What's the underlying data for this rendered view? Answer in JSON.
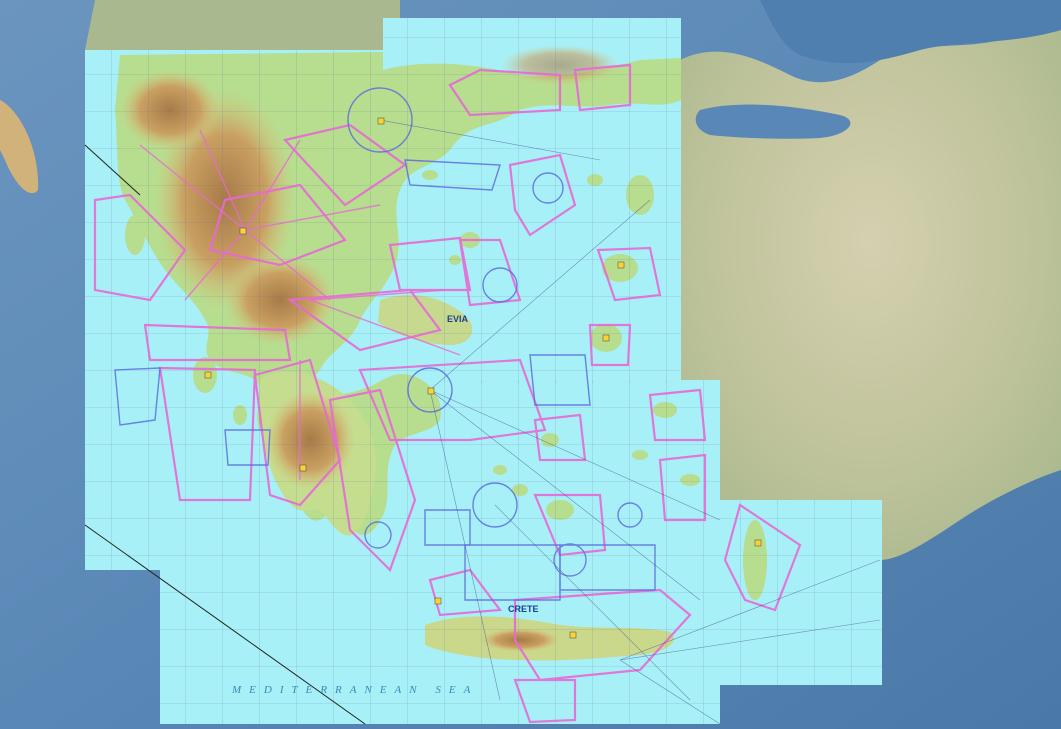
{
  "map": {
    "labels": {
      "evia": "EVIA",
      "crete": "CRETE",
      "sea": "MEDITERRANEAN SEA"
    },
    "colors": {
      "sea_outer": "#4f7fae",
      "chart_water": "#a8f0f7",
      "land_lowland": "#b7dd8e",
      "land_highland": "#d8b46d",
      "mountain": "#b98a56",
      "airspace_pink": "#e66ad6",
      "airspace_blue": "#5c6ee0",
      "grid_line": "#5a6f9a",
      "turkey_land": "#c8c39f"
    }
  }
}
